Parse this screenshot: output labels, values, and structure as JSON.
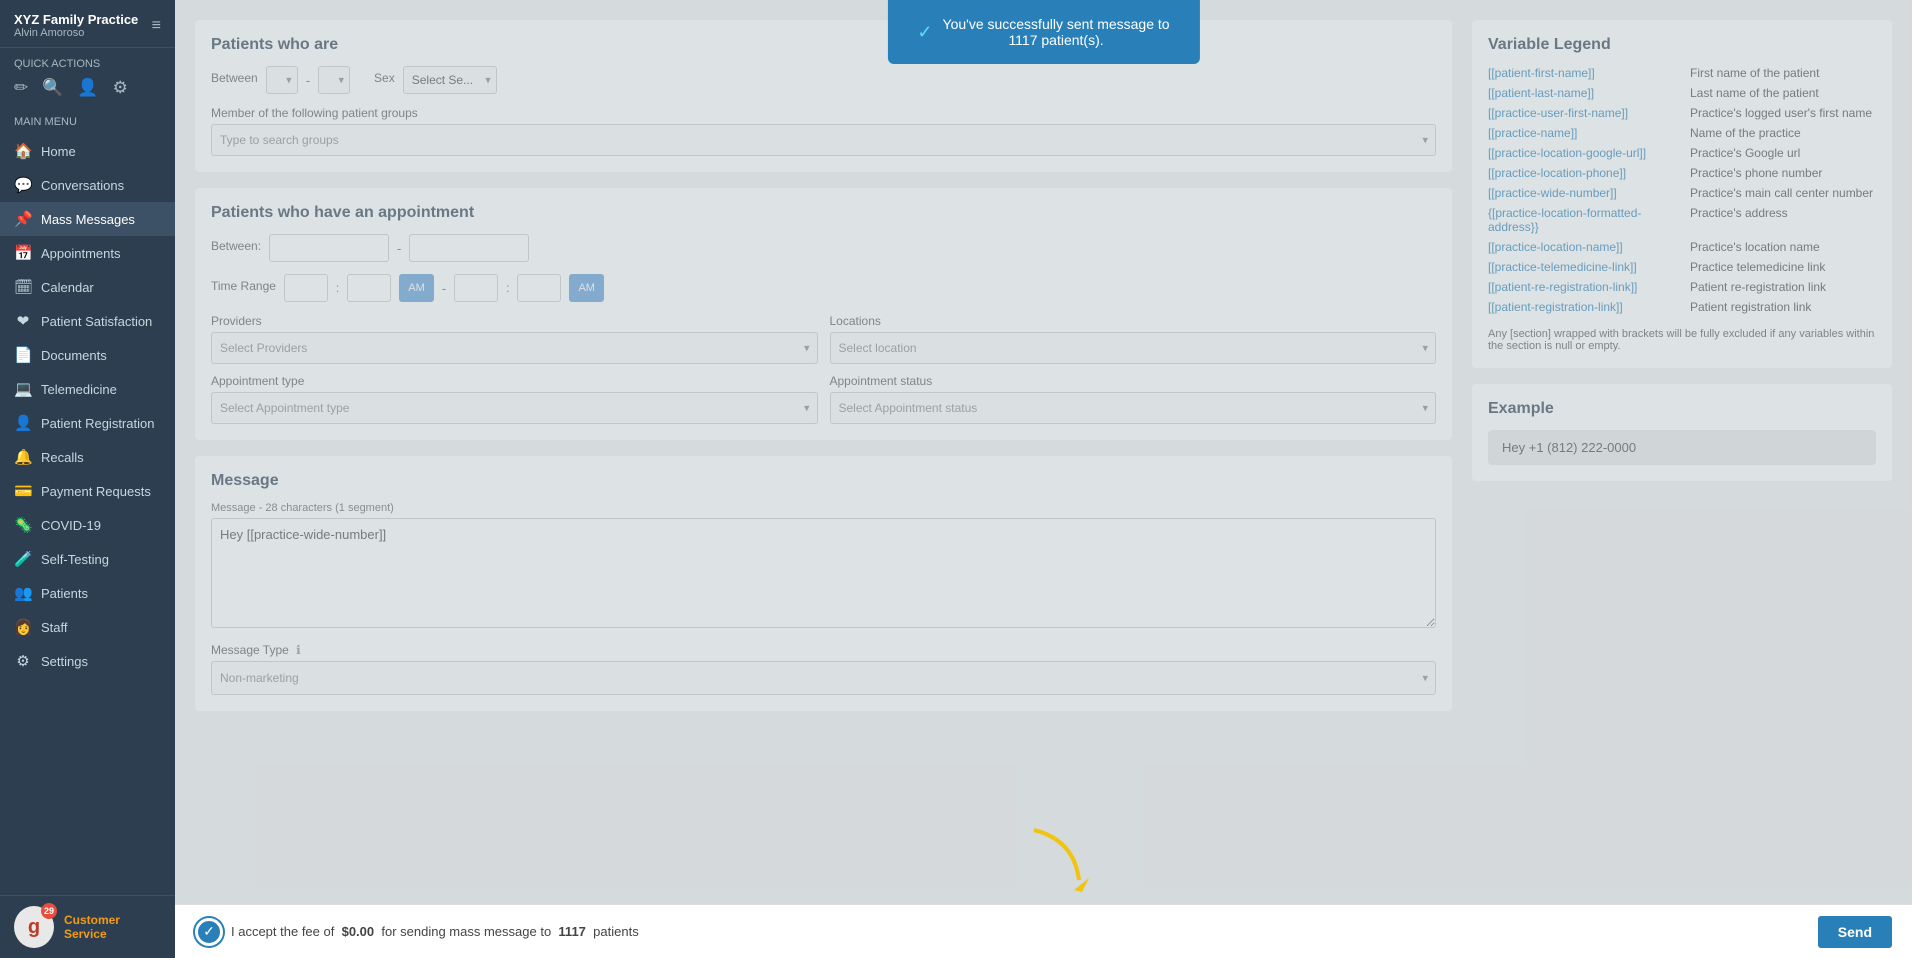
{
  "sidebar": {
    "practice_name": "XYZ Family Practice",
    "user_name": "Alvin Amoroso",
    "hamburger": "≡",
    "quick_actions_label": "Quick Actions",
    "main_menu_label": "Main Menu",
    "menu_items": [
      {
        "label": "Home",
        "icon": "🏠"
      },
      {
        "label": "Conversations",
        "icon": "💬"
      },
      {
        "label": "Mass Messages",
        "icon": "📌"
      },
      {
        "label": "Appointments",
        "icon": "📅"
      },
      {
        "label": "Calendar",
        "icon": "🗓"
      },
      {
        "label": "Patient Satisfaction",
        "icon": "❤"
      },
      {
        "label": "Documents",
        "icon": "📄"
      },
      {
        "label": "Telemedicine",
        "icon": "💻"
      },
      {
        "label": "Patient Registration",
        "icon": "👤"
      },
      {
        "label": "Recalls",
        "icon": "🔔"
      },
      {
        "label": "Payment Requests",
        "icon": "💳"
      },
      {
        "label": "COVID-19",
        "icon": "🦠"
      },
      {
        "label": "Self-Testing",
        "icon": "🧪"
      },
      {
        "label": "Patients",
        "icon": "👥"
      },
      {
        "label": "Staff",
        "icon": "👩"
      },
      {
        "label": "Settings",
        "icon": "⚙"
      }
    ],
    "avatar_letter": "g",
    "avatar_badge": "29",
    "customer_service_label": "Customer Service"
  },
  "toast": {
    "message_line1": "You've successfully sent message to",
    "message_line2": "1117 patient(s)."
  },
  "patients_section": {
    "title": "Patients who are",
    "between_label": "Between",
    "sex_label": "Sex",
    "select_sex_placeholder": "Select Se...",
    "patient_groups_label": "Member of the following patient groups",
    "patient_groups_placeholder": "Type to search groups"
  },
  "appointment_section": {
    "title": "Patients who have an appointment",
    "between_label": "Between:",
    "time_range_label": "Time Range",
    "time1_h": "",
    "time1_m": "",
    "ampm1": "AM",
    "time2_h": "",
    "time2_m": "",
    "ampm2": "AM",
    "providers_label": "Providers",
    "providers_placeholder": "Select Providers",
    "locations_label": "Locations",
    "locations_placeholder": "Select location",
    "appt_type_label": "Appointment type",
    "appt_type_placeholder": "Select Appointment type",
    "appt_status_label": "Appointment status",
    "appt_status_placeholder": "Select Appointment status"
  },
  "message_section": {
    "title": "Message",
    "char_count_label": "Message - 28 characters (1 segment)",
    "message_value": "Hey [[practice-wide-number]]",
    "message_type_label": "Message Type",
    "message_type_info": "ℹ",
    "message_type_value": "Non-marketing"
  },
  "variable_legend": {
    "title": "Variable Legend",
    "variables": [
      {
        "tag": "[[patient-first-name]]",
        "desc": "First name of the patient"
      },
      {
        "tag": "[[patient-last-name]]",
        "desc": "Last name of the patient"
      },
      {
        "tag": "[[practice-user-first-name]]",
        "desc": "Practice's logged user's first name"
      },
      {
        "tag": "[[practice-name]]",
        "desc": "Name of the practice"
      },
      {
        "tag": "[[practice-location-google-url]]",
        "desc": "Practice's Google url"
      },
      {
        "tag": "[[practice-location-phone]]",
        "desc": "Practice's phone number"
      },
      {
        "tag": "[[practice-wide-number]]",
        "desc": "Practice's main call center number"
      },
      {
        "tag": "{[practice-location-formatted-address}}",
        "desc": "Practice's address"
      },
      {
        "tag": "[[practice-location-name]]",
        "desc": "Practice's location name"
      },
      {
        "tag": "[[practice-telemedicine-link]]",
        "desc": "Practice telemedicine link"
      },
      {
        "tag": "[[patient-re-registration-link]]",
        "desc": "Patient re-registration link"
      },
      {
        "tag": "[[patient-registration-link]]",
        "desc": "Patient registration link"
      }
    ],
    "note": "Any [section] wrapped with brackets will be fully excluded if any variables within the section is null or empty."
  },
  "example_section": {
    "title": "Example",
    "example_text": "Hey +1 (812) 222-0000"
  },
  "bottom_bar": {
    "accept_text_prefix": "I accept the fee of",
    "fee": "$0.00",
    "accept_text_mid": "for sending mass message to",
    "patient_count": "1117",
    "accept_text_suffix": "patients",
    "send_label": "Send"
  }
}
